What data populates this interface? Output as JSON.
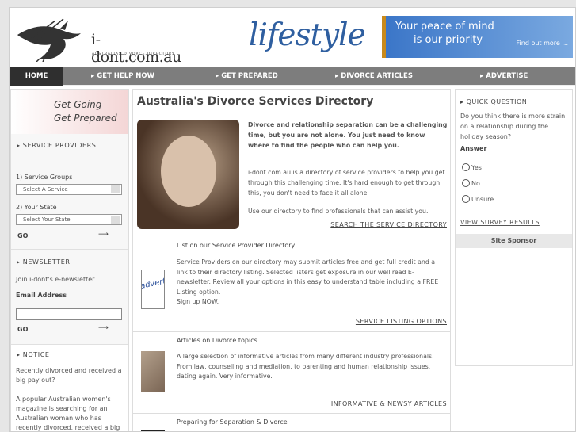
{
  "header": {
    "logo_text": "i-dont.com.au",
    "logo_sub": "AUSTRALIAS DIVORCE DIRECTORY",
    "lifestyle": "lifestyle",
    "banner_line1": "Your peace of mind",
    "banner_line2": "is our priority",
    "banner_link": "Find out more ..."
  },
  "nav": {
    "home": "HOME",
    "items": [
      "GET HELP NOW",
      "GET PREPARED",
      "DIVORCE ARTICLES",
      "ADVERTISE"
    ]
  },
  "left": {
    "slogan1": "Get Going",
    "slogan2": "Get Prepared",
    "service_title": "SERVICE PROVIDERS",
    "step1": "1) Service Groups",
    "select1": "Select A Service",
    "step2": "2) Your State",
    "select2": "Select Your State",
    "go": "GO",
    "newsletter_title": "NEWSLETTER",
    "newsletter_text": "Join i-dont's e-newsletter.",
    "email_label": "Email Address",
    "go2": "GO",
    "notice_title": "NOTICE",
    "notice_p1": "Recently divorced and received a big pay out?",
    "notice_p2": "A popular Australian women's magazine is searching for an Australian woman who has recently divorced, received a big"
  },
  "center": {
    "title": "Australia's Divorce Services Directory",
    "intro_bold": "Divorce and relationship separation can be a challenging time, but you are not alone. You just need to know where to find the people who can help you.",
    "intro_p2": "i-dont.com.au is a directory of service providers to help you get through this challenging time. It's hard enough to get through this, you don't need to face it all alone.",
    "intro_p3": "Use our directory to find professionals that can assist you.",
    "link1": "SEARCH THE SERVICE DIRECTORY",
    "s1_title": "List on our Service Provider Directory",
    "s1_text": "Service Providers on our directory may submit articles free and get full credit and a link to their directory listing. Selected listers get exposure in our well read E-newsletter. Review all your options in this easy to understand table including a FREE Listing option.",
    "s1_signup": "Sign up NOW.",
    "s1_img": "advertising",
    "link2": "SERVICE LISTING OPTIONS",
    "s2_title": "Articles on Divorce topics",
    "s2_text": "A large selection of informative articles from many different industry professionals. From law, counselling and mediation, to parenting and human relationship issues, dating again. Very informative.",
    "link3": "INFORMATIVE & NEWSY ARTICLES",
    "s3_title": "Preparing for Separation & Divorce"
  },
  "right": {
    "title": "QUICK QUESTION",
    "question": "Do you think there is more strain on a relationship during the holiday season?",
    "answer_label": "Answer",
    "options": [
      "Yes",
      "No",
      "Unsure"
    ],
    "results_link": "VIEW SURVEY RESULTS",
    "sponsor": "Site Sponsor"
  },
  "colors": {
    "nav_bg": "#7d7d7d",
    "nav_active": "#2f2f2f",
    "banner": "#3b76c8",
    "lifestyle": "#2f5fa0"
  }
}
